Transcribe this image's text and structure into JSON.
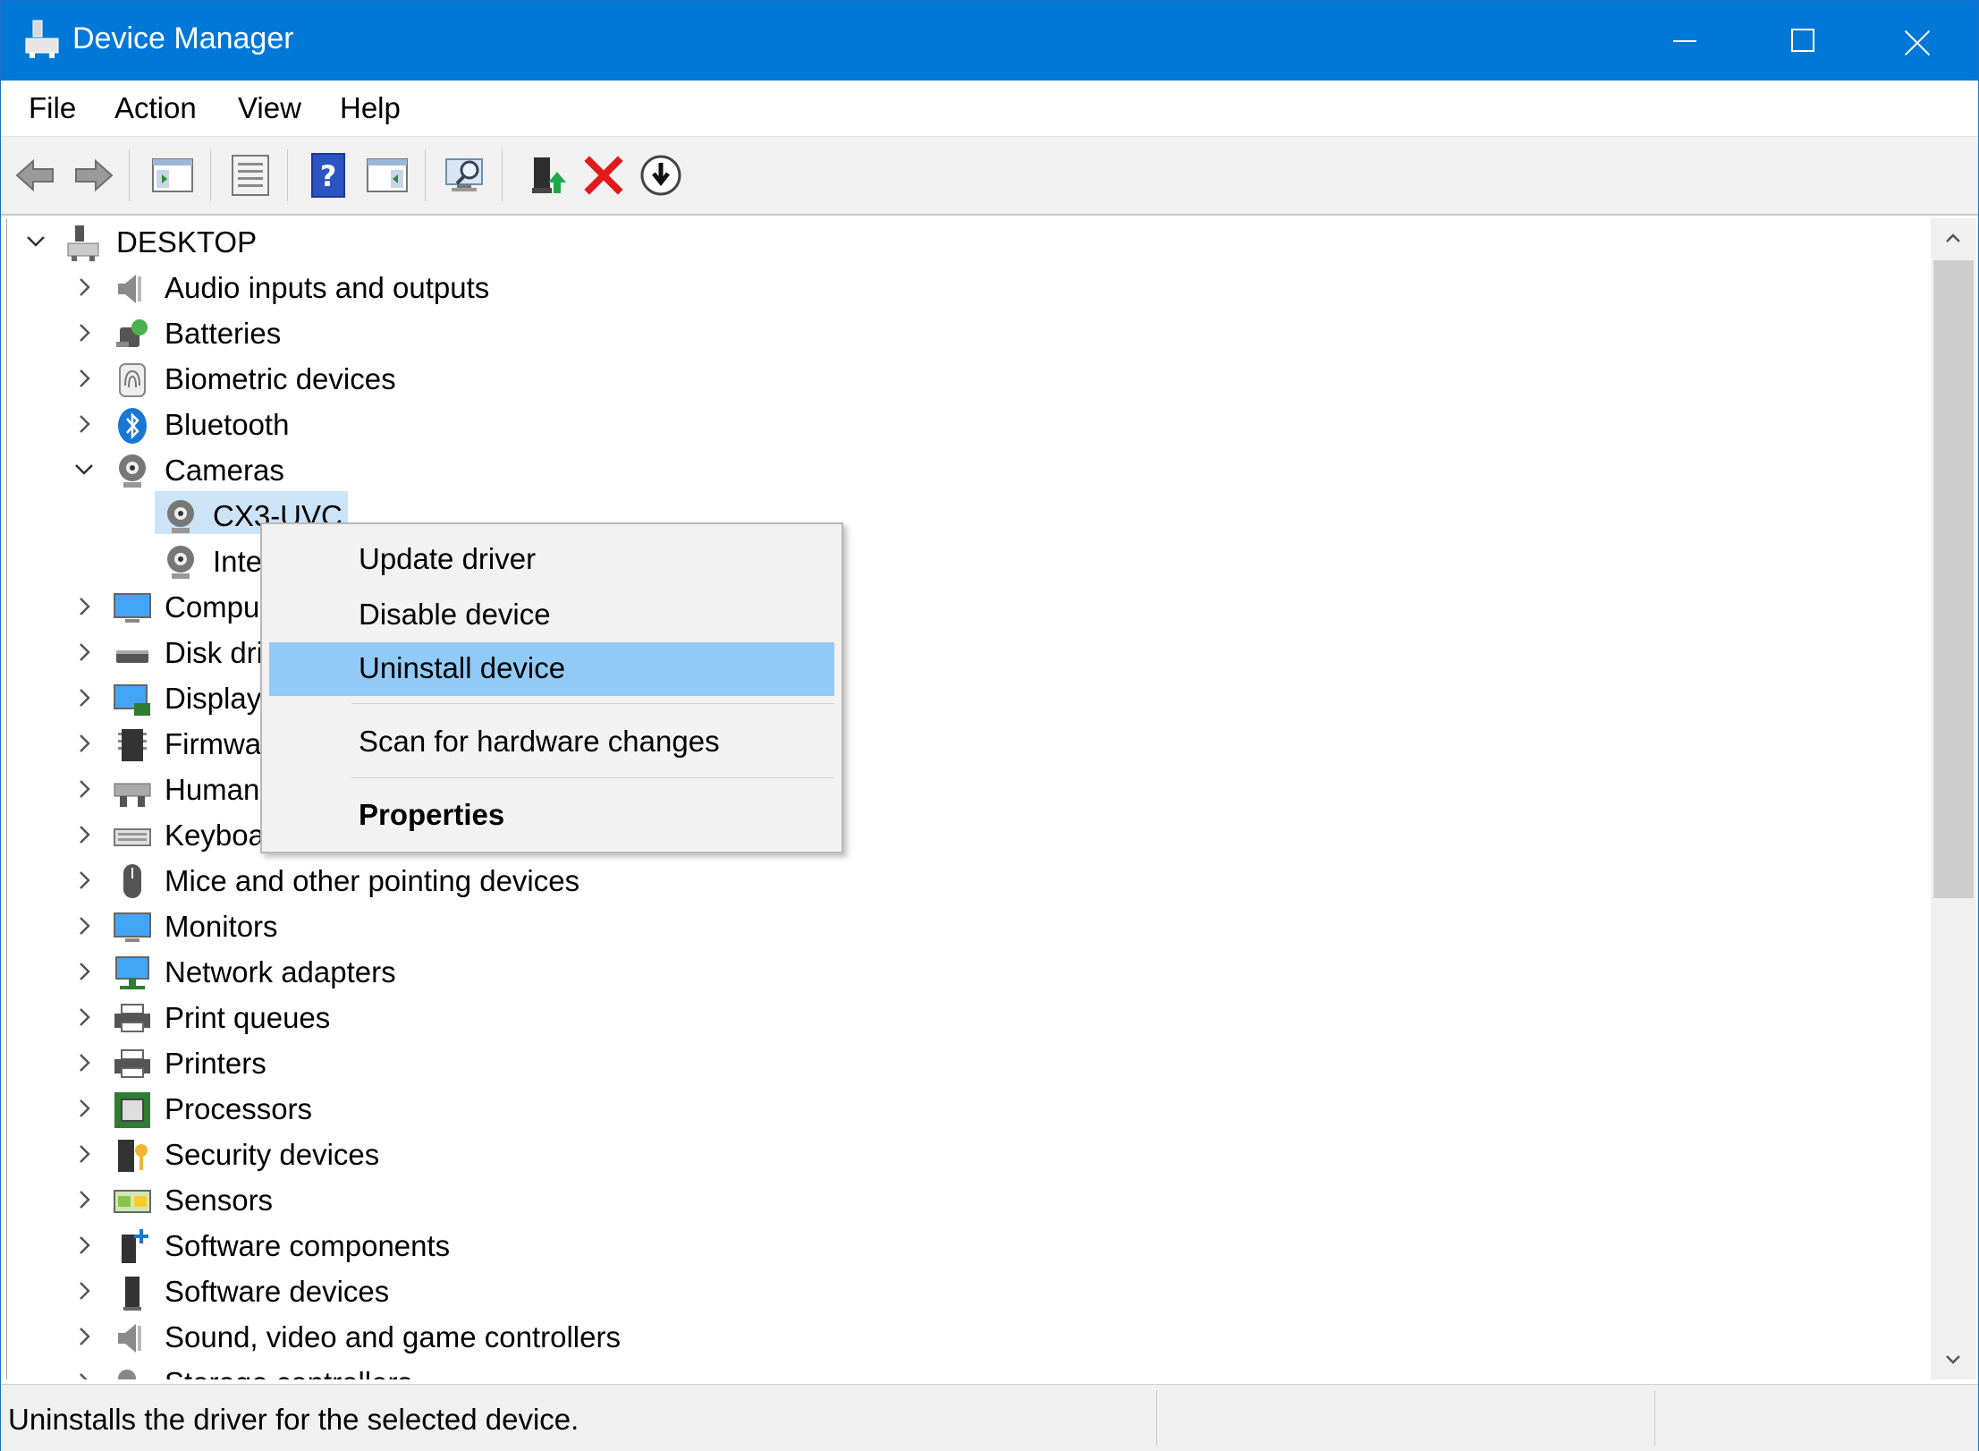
{
  "window": {
    "title": "Device Manager"
  },
  "menubar": {
    "items": [
      "File",
      "Action",
      "View",
      "Help"
    ]
  },
  "toolbar": {
    "icons": [
      "back-icon",
      "forward-icon",
      "show-hide-console-tree-icon",
      "properties-icon",
      "help-icon",
      "action-pane-icon",
      "scan-hardware-icon",
      "update-driver-icon",
      "uninstall-icon",
      "disable-icon"
    ]
  },
  "tree": {
    "root": "DESKTOP",
    "items": [
      "Audio inputs and outputs",
      "Batteries",
      "Biometric devices",
      "Bluetooth",
      "Cameras",
      "CX3-UVC",
      "Inte",
      "Compu",
      "Disk dri",
      "Display",
      "Firmwa",
      "Human",
      "Keyboa",
      "Mice and other pointing devices",
      "Monitors",
      "Network adapters",
      "Print queues",
      "Printers",
      "Processors",
      "Security devices",
      "Sensors",
      "Software components",
      "Software devices",
      "Sound, video and game controllers",
      "Storage controllers"
    ]
  },
  "context_menu": {
    "update": "Update driver",
    "disable": "Disable device",
    "uninstall": "Uninstall device",
    "scan": "Scan for hardware changes",
    "properties": "Properties"
  },
  "status": {
    "text": "Uninstalls the driver for the selected device."
  },
  "colors": {
    "titlebar": "#0078d7",
    "selection": "#cce4f7",
    "menu_highlight": "#91c9f7"
  }
}
